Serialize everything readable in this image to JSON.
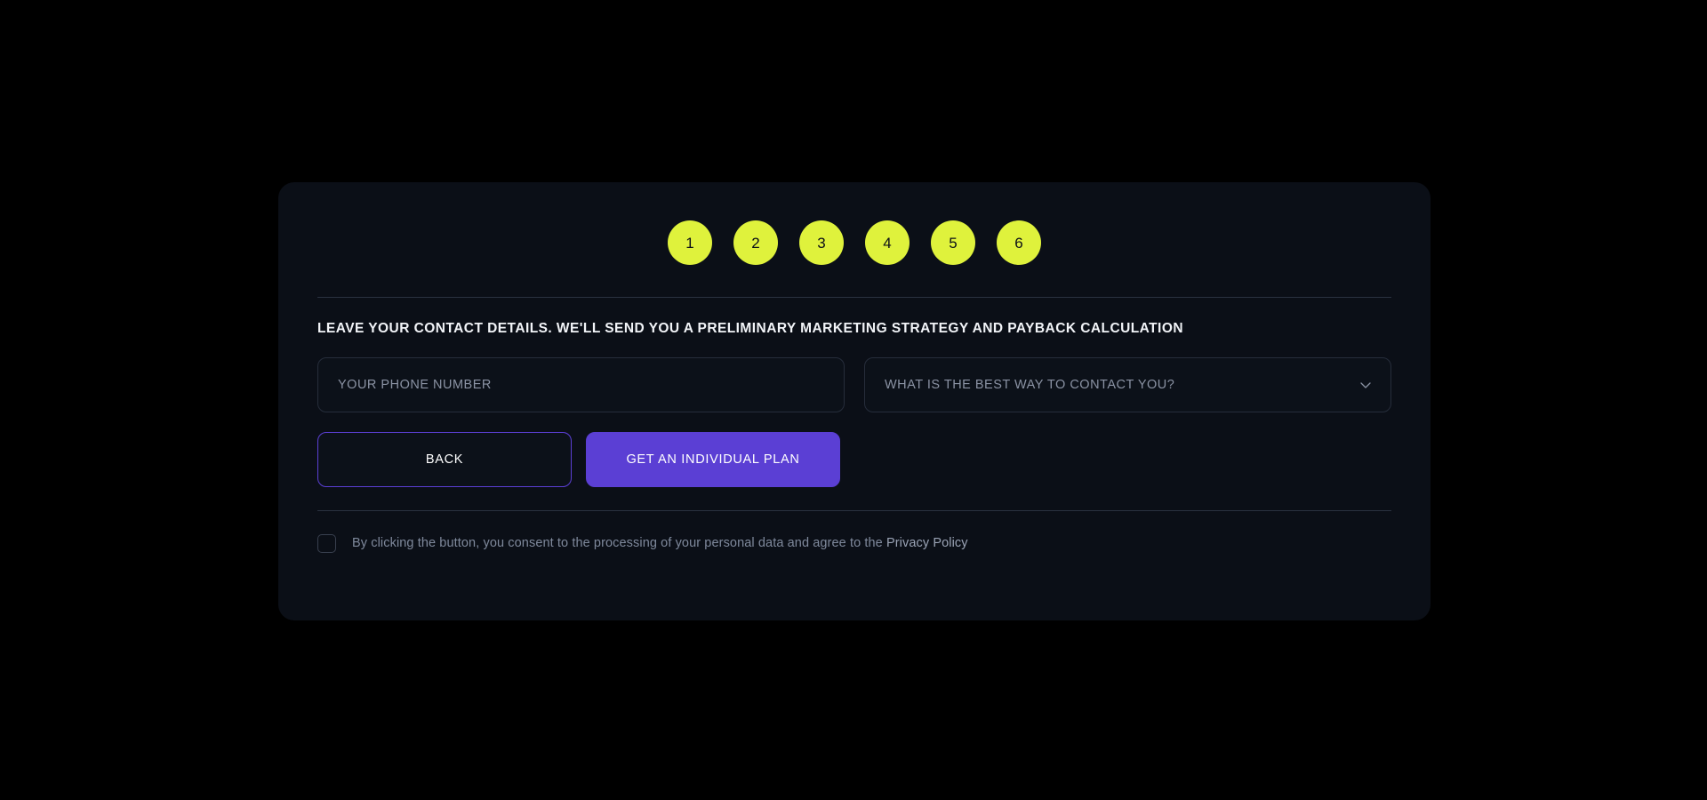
{
  "theme": {
    "page_background": "#000000",
    "card_background": "#0b0f17",
    "accent_yellow": "#dff23c",
    "accent_purple": "#5b3fd4",
    "divider": "#2a3140",
    "muted_text": "#8b93a4"
  },
  "quiz": {
    "steps": [
      {
        "label": "1"
      },
      {
        "label": "2"
      },
      {
        "label": "3"
      },
      {
        "label": "4"
      },
      {
        "label": "5"
      },
      {
        "label": "6"
      }
    ],
    "heading": "LEAVE YOUR CONTACT DETAILS. WE'LL SEND YOU A PRELIMINARY MARKETING STRATEGY AND PAYBACK CALCULATION",
    "fields": {
      "phone": {
        "placeholder": "YOUR PHONE NUMBER",
        "value": ""
      },
      "contact_method": {
        "placeholder": "WHAT IS THE BEST WAY TO CONTACT YOU?",
        "value": "",
        "icon": "chevron-down-icon"
      }
    },
    "buttons": {
      "back": "BACK",
      "submit": "GET AN INDIVIDUAL PLAN"
    },
    "consent": {
      "checked": false,
      "text": "By clicking the button, you consent to the processing of your personal data and agree to the ",
      "policy_link": "Privacy Policy"
    }
  }
}
